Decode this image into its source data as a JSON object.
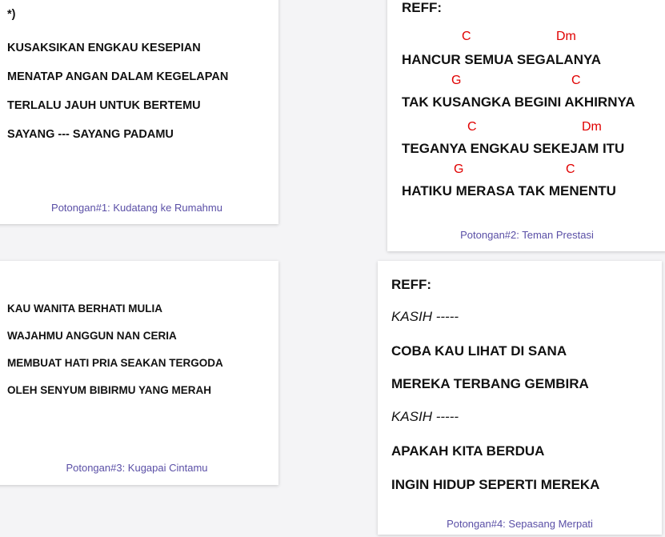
{
  "card1": {
    "marker": "*)",
    "lines": [
      "KUSAKSIKAN ENGKAU KESEPIAN",
      "MENATAP ANGAN DALAM KEGELAPAN",
      "TERLALU JAUH UNTUK BERTEMU",
      "SAYANG --- SAYANG PADAMU"
    ],
    "caption": "Potongan#1: Kudatang ke Rumahmu"
  },
  "card2": {
    "heading": "REFF:",
    "chords": [
      [
        "C",
        "Dm"
      ],
      [
        "G",
        "C"
      ],
      [
        "C",
        "Dm"
      ],
      [
        "G",
        "C"
      ]
    ],
    "lines": [
      "HANCUR SEMUA SEGALANYA",
      "TAK KUSANGKA BEGINI AKHIRNYA",
      "TEGANYA ENGKAU SEKEJAM ITU",
      "HATIKU MERASA TAK MENENTU"
    ],
    "caption": "Potongan#2: Teman Prestasi"
  },
  "card3": {
    "lines": [
      "KAU WANITA BERHATI MULIA",
      "WAJAHMU ANGGUN NAN CERIA",
      "MEMBUAT HATI PRIA SEAKAN TERGODA",
      "OLEH SENYUM BIBIRMU YANG MERAH"
    ],
    "caption": "Potongan#3: Kugapai Cintamu"
  },
  "card4": {
    "heading": "REFF:",
    "lines": [
      "KASIH -----",
      "COBA KAU LIHAT DI SANA",
      "MEREKA TERBANG GEMBIRA",
      "KASIH -----",
      "APAKAH KITA BERDUA",
      "INGIN HIDUP SEPERTI MEREKA"
    ],
    "caption": "Potongan#4: Sepasang Merpati"
  },
  "colors": {
    "chord": "#e00000",
    "caption": "#5a4fa6"
  }
}
